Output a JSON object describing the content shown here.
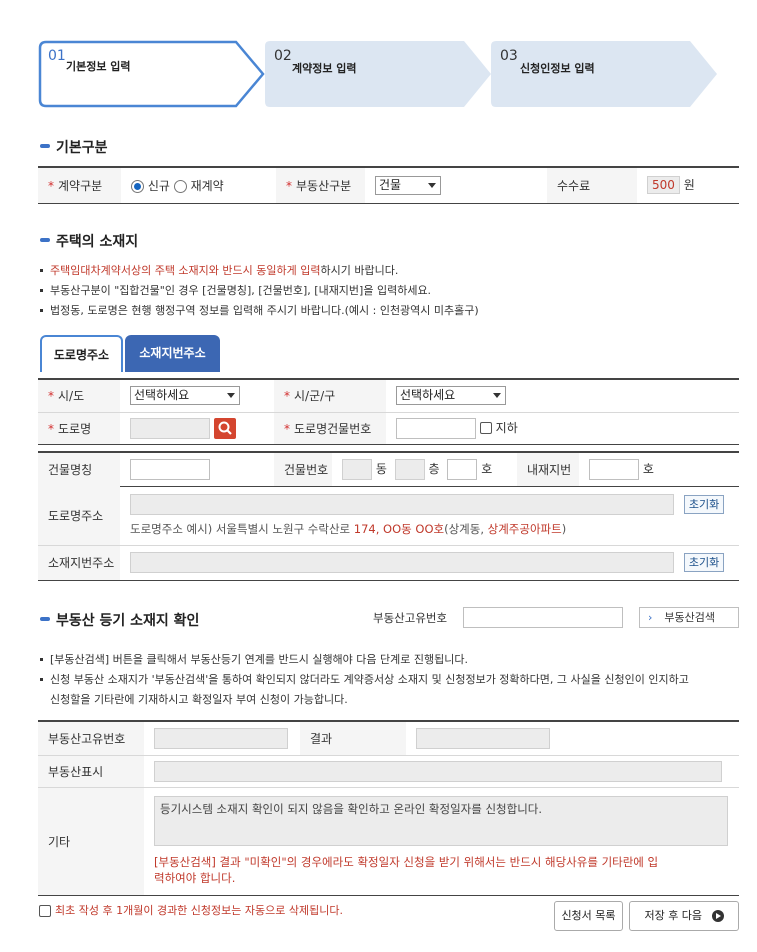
{
  "steps": [
    {
      "num": "01",
      "label": "기본정보 입력"
    },
    {
      "num": "02",
      "label": "계약정보 입력"
    },
    {
      "num": "03",
      "label": "신청인정보 입력"
    }
  ],
  "basic": {
    "title": "기본구분",
    "contract_type_label": "계약구분",
    "opt_new": "신규",
    "opt_renew": "재계약",
    "property_type_label": "부동산구분",
    "property_type_value": "건물",
    "fee_label": "수수료",
    "fee_value": "500",
    "fee_unit": "원"
  },
  "location": {
    "title": "주택의 소재지",
    "notes": [
      "주택임대차계약서상의 주택 소재지와 반드시 동일하게 입력",
      "하시기 바랍니다.",
      "부동산구분이 \"집합건물\"인 경우 [건물명칭], [건물번호], [내재지번]을 입력하세요.",
      "법정동, 도로명은 현행 행정구역 정보를 입력해 주시기 바랍니다.(예시 : 인천광역시 미추홀구)"
    ],
    "tab_road": "도로명주소",
    "tab_lot": "소재지번주소",
    "sido_label": "시/도",
    "sido_value": "선택하세요",
    "sigungu_label": "시/군/구",
    "sigungu_value": "선택하세요",
    "road_label": "도로명",
    "road_bldg_no_label": "도로명건물번호",
    "basement_label": "지하",
    "bldg_name_label": "건물명칭",
    "bldg_no_label": "건물번호",
    "dong_unit": "동",
    "floor_unit": "층",
    "ho_unit": "호",
    "inner_lot_label": "내재지번",
    "inner_ho_unit": "호",
    "road_addr_label": "도로명주소",
    "reset": "초기화",
    "example_prefix": "도로명주소 예시) 서울특별시 노원구 수락산로 ",
    "example_red1": "174, OO동 OO호",
    "example_mid": "(상계동, ",
    "example_red2": "상계주공아파트",
    "example_suffix": ")",
    "lot_addr_label": "소재지번주소"
  },
  "registry": {
    "title": "부동산 등기 소재지 확인",
    "unique_no_label": "부동산고유번호",
    "search_btn": "부동산검색",
    "notes": [
      "[부동산검색] 버튼을 클릭해서 부동산등기 연계를 반드시 실행해야 다음 단계로 진행됩니다.",
      "신청 부동산 소재지가 '부동산검색'을 통하여 확인되지 않더라도 계약증서상 소재지 및 신청정보가 정확하다면, 그 사실을 신청인이 인지하고",
      "신청할을 기타란에 기재하시고 확정일자 부여 신청이 가능합니다."
    ],
    "t_unique_no": "부동산고유번호",
    "t_result": "결과",
    "t_display": "부동산표시",
    "t_etc": "기타",
    "etc_text": "등기시스템 소재지 확인이 되지 않음을 확인하고 온라인 확정일자를 신청합니다.",
    "etc_warn1": "[부동산검색] 결과 \"미확인\"의 경우에라도 확정일자 신청을 받기 위해서는 반드시 해당사유를 기타란에 입",
    "etc_warn2": "력하여야 합니다."
  },
  "footer": {
    "auto_delete": "최초 작성 후 1개월이 경과한 신청정보는 자동으로 삭제됩니다.",
    "list_btn": "신청서 목록",
    "next_btn": "저장 후 다음"
  }
}
